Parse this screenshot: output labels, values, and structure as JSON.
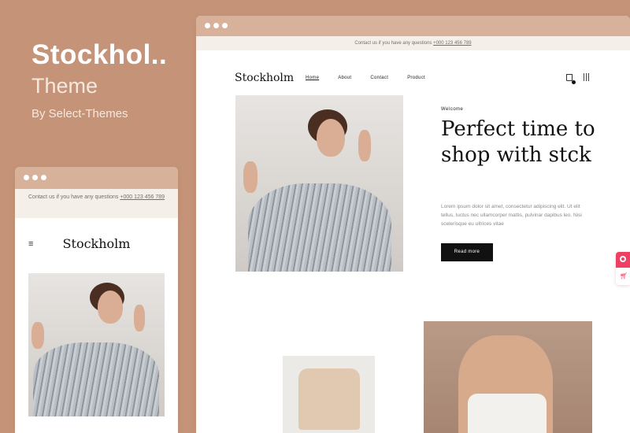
{
  "promo": {
    "title": "Stockhol..",
    "subtitle": "Theme",
    "byline": "By Select-Themes"
  },
  "desktop": {
    "topbar": {
      "text": "Contact us if you have any questions ",
      "phone": "+000 123 456 789"
    },
    "logo": "Stockholm",
    "menu": [
      {
        "label": "Home",
        "active": true
      },
      {
        "label": "About",
        "active": false
      },
      {
        "label": "Contact",
        "active": false
      },
      {
        "label": "Product",
        "active": false
      }
    ],
    "hero": {
      "eyebrow": "Welcome",
      "heading": "Perfect time to shop with stck",
      "description": "Lorem ipsum dolor sit amet, consectetur adipiscing elit. Ut elit tellus, luctus nec ullamcorper mattis, pulvinar dapibus leo. Nisi scelerisque eu ultrices vitae",
      "button": "Read more"
    },
    "icons": {
      "cart": "cart-icon",
      "menu": "menu-bars-icon"
    }
  },
  "mobile": {
    "topbar": {
      "text": "Contact us if you have any questions ",
      "phone": "+000 123 456 789"
    },
    "logo": "Stockholm",
    "menu_icon": "≡"
  },
  "colors": {
    "background": "#c59478",
    "window_bar": "#d7b19a",
    "accent_widget": "#ef3f63",
    "button": "#111111"
  }
}
